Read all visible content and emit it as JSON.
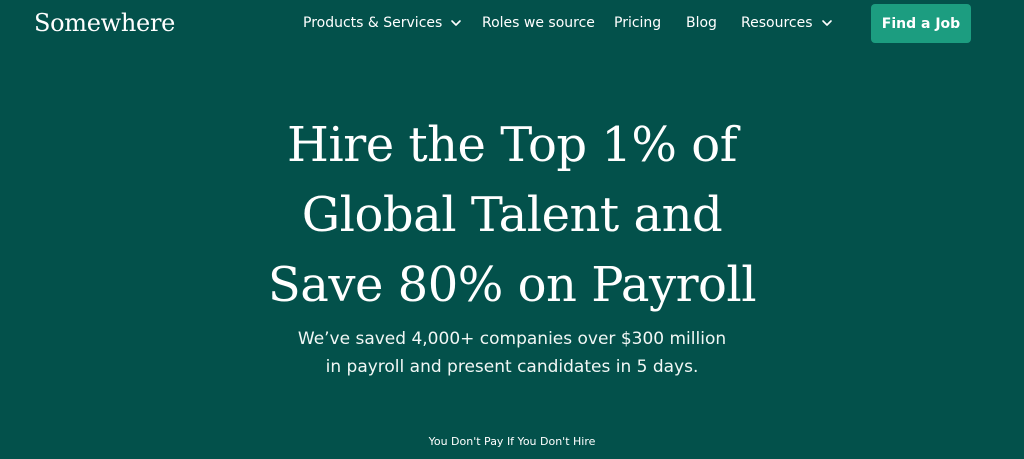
{
  "header": {
    "logo": "Somewhere",
    "nav": [
      {
        "label": "Products & Services",
        "icon": "chevron-down-icon"
      },
      {
        "label": "Roles we source"
      },
      {
        "label": "Pricing"
      },
      {
        "label": "Blog"
      },
      {
        "label": "Resources",
        "icon": "chevron-down-icon"
      }
    ],
    "cta_label": "Find a Job"
  },
  "hero": {
    "headline_lines": [
      "Hire the Top 1% of",
      "Global Talent and",
      "Save 80% on Payroll"
    ],
    "subtext_lines": [
      "We’ve saved 4,000+ companies over $300 million",
      "in payroll and present candidates in 5 days."
    ],
    "tagline": "You Don't Pay If You Don't Hire"
  },
  "colors": {
    "background": "#03514b",
    "cta": "#1c9d80",
    "text": "#ffffff"
  }
}
